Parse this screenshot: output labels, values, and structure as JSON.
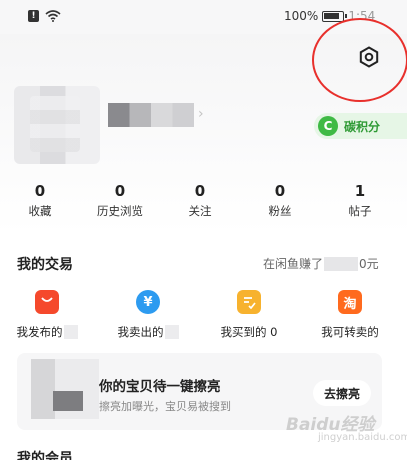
{
  "status_bar": {
    "battery_percent": "100%",
    "time": "1:54"
  },
  "header": {
    "carbon_badge": {
      "icon_letter": "C",
      "label": "碳积分"
    }
  },
  "stats": [
    {
      "value": "0",
      "label": "收藏"
    },
    {
      "value": "0",
      "label": "历史浏览"
    },
    {
      "value": "0",
      "label": "关注"
    },
    {
      "value": "0",
      "label": "粉丝"
    },
    {
      "value": "1",
      "label": "帖子"
    }
  ],
  "trades": {
    "title": "我的交易",
    "earn_prefix": "在闲鱼赚了",
    "earn_suffix": "0元",
    "items": [
      {
        "icon_glyph": "",
        "label": "我发布的",
        "color": "#f5492c"
      },
      {
        "icon_glyph": "¥",
        "label": "我卖出的",
        "color": "#2d9bf0"
      },
      {
        "icon_glyph": "",
        "label": "我买到的 0",
        "color": "#f7b22e"
      },
      {
        "icon_glyph": "淘",
        "label": "我可转卖的",
        "color": "#ff6a1e"
      }
    ]
  },
  "promo": {
    "title": "你的宝贝待一键擦亮",
    "subtitle": "擦亮加曝光，宝贝易被搜到",
    "button_label": "去擦亮"
  },
  "next_section": {
    "title": "我的会员"
  },
  "watermark": {
    "text": "Baidu经验",
    "sub": "jingyan.baidu.com"
  }
}
